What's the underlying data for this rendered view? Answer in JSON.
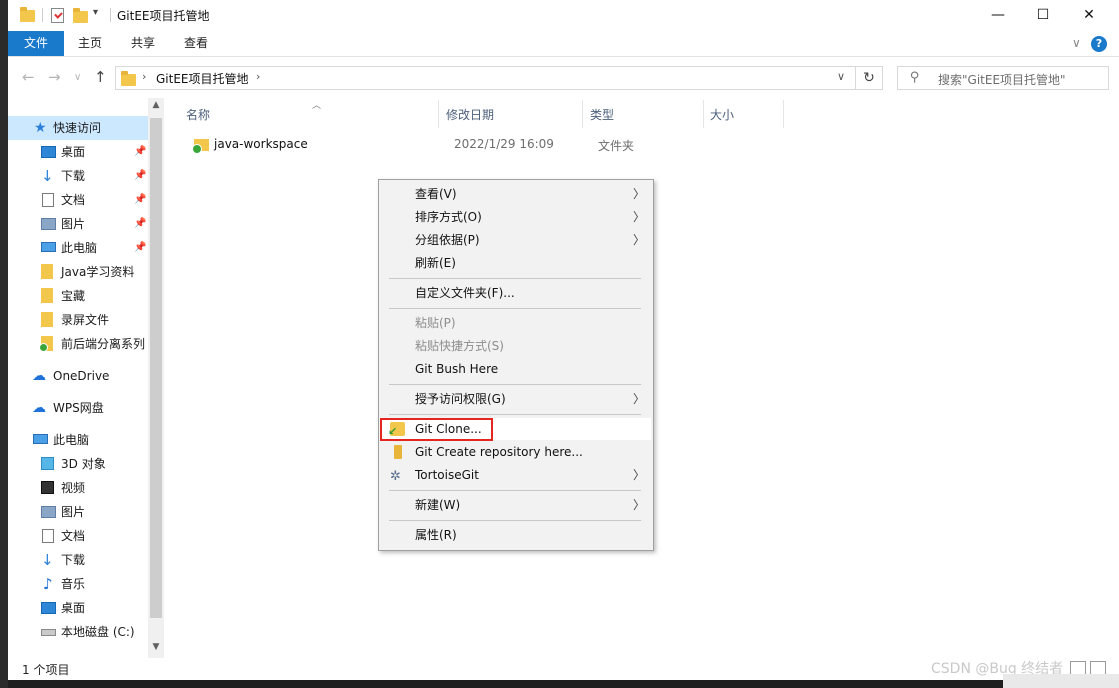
{
  "window": {
    "title": "GitEE项目托管地",
    "controls": {
      "minimize": "—",
      "maximize": "☐",
      "close": "✕"
    }
  },
  "ribbon": {
    "tabs": [
      "文件",
      "主页",
      "共享",
      "查看"
    ],
    "active_tab": "文件",
    "expand_icon": "chevron-down-icon",
    "help_glyph": "?"
  },
  "address": {
    "path": "GitEE项目托管地",
    "search_placeholder": "搜索\"GitEE项目托管地\""
  },
  "sidebar": {
    "items": [
      {
        "label": "快速访问",
        "icon": "star-icon",
        "pinned": false
      },
      {
        "label": "桌面",
        "icon": "desktop-icon",
        "pinned": true
      },
      {
        "label": "下载",
        "icon": "download-icon",
        "pinned": true
      },
      {
        "label": "文档",
        "icon": "document-icon",
        "pinned": true
      },
      {
        "label": "图片",
        "icon": "pictures-icon",
        "pinned": true
      },
      {
        "label": "此电脑",
        "icon": "computer-icon",
        "pinned": true
      },
      {
        "label": "Java学习资料",
        "icon": "folder-icon",
        "pinned": false
      },
      {
        "label": "宝藏",
        "icon": "folder-icon",
        "pinned": false
      },
      {
        "label": "录屏文件",
        "icon": "folder-icon",
        "pinned": false
      },
      {
        "label": "前后端分离系列",
        "icon": "git-folder-icon",
        "pinned": false
      },
      {
        "label": "OneDrive",
        "icon": "cloud-icon",
        "pinned": false
      },
      {
        "label": "WPS网盘",
        "icon": "cloud-icon",
        "pinned": false
      },
      {
        "label": "此电脑",
        "icon": "computer-icon",
        "pinned": false
      },
      {
        "label": "3D 对象",
        "icon": "3d-objects-icon",
        "pinned": false
      },
      {
        "label": "视频",
        "icon": "video-icon",
        "pinned": false
      },
      {
        "label": "图片",
        "icon": "pictures-icon",
        "pinned": false
      },
      {
        "label": "文档",
        "icon": "document-icon",
        "pinned": false
      },
      {
        "label": "下载",
        "icon": "download-icon",
        "pinned": false
      },
      {
        "label": "音乐",
        "icon": "music-icon",
        "pinned": false
      },
      {
        "label": "桌面",
        "icon": "desktop-icon",
        "pinned": false
      },
      {
        "label": "本地磁盘 (C:)",
        "icon": "disk-icon",
        "pinned": false
      }
    ]
  },
  "file_list": {
    "columns": [
      "名称",
      "修改日期",
      "类型",
      "大小"
    ],
    "rows": [
      {
        "name": "java-workspace",
        "modified": "2022/1/29 16:09",
        "type": "文件夹",
        "size": ""
      }
    ]
  },
  "status": {
    "item_count": "1 个项目"
  },
  "context_menu": {
    "items": [
      {
        "label": "查看(V)",
        "submenu": true,
        "disabled": false
      },
      {
        "label": "排序方式(O)",
        "submenu": true,
        "disabled": false
      },
      {
        "label": "分组依据(P)",
        "submenu": true,
        "disabled": false
      },
      {
        "label": "刷新(E)",
        "submenu": false,
        "disabled": false
      },
      {
        "label": "自定义文件夹(F)...",
        "submenu": false,
        "disabled": false
      },
      {
        "label": "粘贴(P)",
        "submenu": false,
        "disabled": true
      },
      {
        "label": "粘贴快捷方式(S)",
        "submenu": false,
        "disabled": true
      },
      {
        "label": "Git Bush Here",
        "submenu": false,
        "disabled": false
      },
      {
        "label": "授予访问权限(G)",
        "submenu": true,
        "disabled": false
      },
      {
        "label": "Git Clone...",
        "submenu": false,
        "disabled": false,
        "highlighted": true
      },
      {
        "label": "Git Create repository here...",
        "submenu": false,
        "disabled": false
      },
      {
        "label": "TortoiseGit",
        "submenu": true,
        "disabled": false
      },
      {
        "label": "新建(W)",
        "submenu": true,
        "disabled": false
      },
      {
        "label": "属性(R)",
        "submenu": false,
        "disabled": false
      }
    ],
    "highlight_color": "#e42520"
  },
  "watermark": "CSDN @Bug 终结者",
  "colors": {
    "accent": "#1979ca",
    "folder": "#f3c74b",
    "selection": "#cce8ff"
  }
}
